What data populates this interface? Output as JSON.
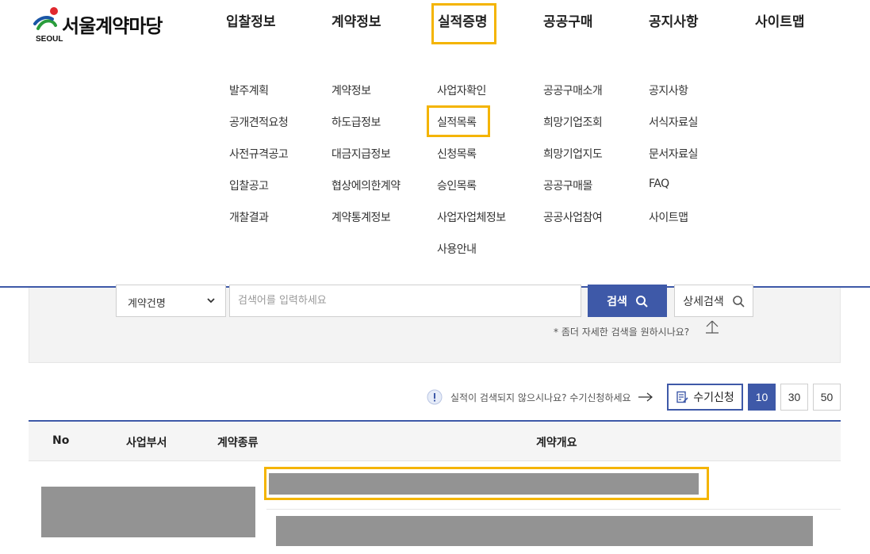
{
  "logo": {
    "title": "서울계약마당",
    "subtitle": "SEOUL"
  },
  "gnb": {
    "items": [
      "입찰정보",
      "계약정보",
      "실적증명",
      "공공구매",
      "공지사항",
      "사이트맵"
    ],
    "active_index": 2
  },
  "megamenu": {
    "columns": [
      [
        "발주계획",
        "공개견적요청",
        "사전규격공고",
        "입찰공고",
        "개찰결과"
      ],
      [
        "계약정보",
        "하도급정보",
        "대금지급정보",
        "협상에의한계약",
        "계약통계정보"
      ],
      [
        "사업자확인",
        "실적목록",
        "신청목록",
        "승인목록",
        "사업자업체정보",
        "사용안내"
      ],
      [
        "공공구매소개",
        "희망기업조회",
        "희망기업지도",
        "공공구매몰",
        "공공사업참여"
      ],
      [
        "공지사항",
        "서식자료실",
        "문서자료실",
        "FAQ",
        "사이트맵"
      ]
    ],
    "active_item": "실적목록"
  },
  "search": {
    "select_value": "계약건명",
    "input_placeholder": "검색어를 입력하세요",
    "input_value": "",
    "search_label": "검색",
    "detail_label": "상세검색",
    "hint": "* 좀더 자세한 검색을 원하시나요?"
  },
  "utility": {
    "notice": "실적이 검색되지 않으시나요? 수기신청하세요",
    "manual_apply_label": "수기신청",
    "page_sizes": [
      "10",
      "30",
      "50"
    ],
    "active_page_size": "10"
  },
  "table": {
    "headers": [
      "No",
      "사업부서",
      "계약종류",
      "계약개요"
    ]
  },
  "colors": {
    "accent": "#3e59a8",
    "highlight": "#f4b400",
    "redacted": "#939393"
  }
}
